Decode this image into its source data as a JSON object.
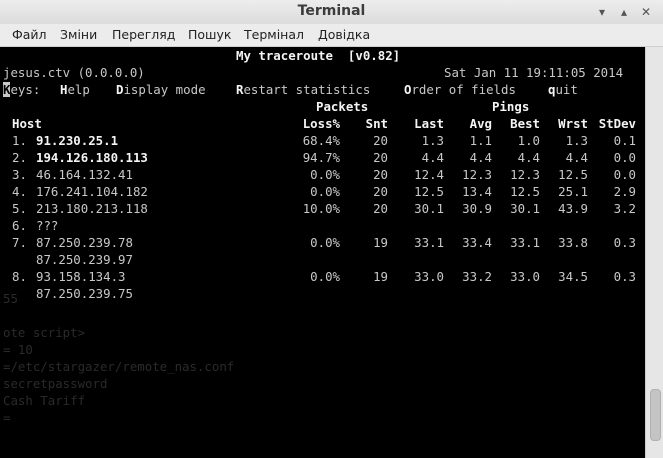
{
  "window": {
    "title": "Terminal"
  },
  "menu": [
    "Файл",
    "Зміни",
    "Перегляд",
    "Пошук",
    "Термінал",
    "Довідка"
  ],
  "mtr": {
    "heading": "My traceroute  [v0.82]",
    "host_info": "jesus.ctv (0.0.0.0)",
    "timestamp": "Sat Jan 11 19:11:05 2014",
    "keys": {
      "label_first": "K",
      "label_rest": "eys:",
      "help_first": "H",
      "help_rest": "elp",
      "display_first": "D",
      "display_rest": "isplay mode",
      "restart_first": "R",
      "restart_rest": "estart statistics",
      "order_first": "O",
      "order_rest": "rder of fields",
      "quit_first": "q",
      "quit_rest": "uit"
    },
    "group_headers": {
      "packets": "Packets",
      "pings": "Pings"
    },
    "columns": {
      "host": "Host",
      "loss": "Loss%",
      "snt": "Snt",
      "last": "Last",
      "avg": "Avg",
      "best": "Best",
      "wrst": "Wrst",
      "stdev": "StDev"
    },
    "hops": [
      {
        "num": "1.",
        "host": "91.230.25.1",
        "loss": "68.4%",
        "snt": "20",
        "last": "1.3",
        "avg": "1.1",
        "best": "1.0",
        "wrst": "1.3",
        "stdev": "0.1"
      },
      {
        "num": "2.",
        "host": "194.126.180.113",
        "loss": "94.7%",
        "snt": "20",
        "last": "4.4",
        "avg": "4.4",
        "best": "4.4",
        "wrst": "4.4",
        "stdev": "0.0"
      },
      {
        "num": "3.",
        "host": "46.164.132.41",
        "loss": "0.0%",
        "snt": "20",
        "last": "12.4",
        "avg": "12.3",
        "best": "12.3",
        "wrst": "12.5",
        "stdev": "0.0"
      },
      {
        "num": "4.",
        "host": "176.241.104.182",
        "loss": "0.0%",
        "snt": "20",
        "last": "12.5",
        "avg": "13.4",
        "best": "12.5",
        "wrst": "25.1",
        "stdev": "2.9"
      },
      {
        "num": "5.",
        "host": "213.180.213.118",
        "loss": "10.0%",
        "snt": "20",
        "last": "30.1",
        "avg": "30.9",
        "best": "30.1",
        "wrst": "43.9",
        "stdev": "3.2"
      },
      {
        "num": "6.",
        "host": "???"
      },
      {
        "num": "7.",
        "host": "87.250.239.78",
        "alt_host": "87.250.239.97",
        "loss": "0.0%",
        "snt": "19",
        "last": "33.1",
        "avg": "33.4",
        "best": "33.1",
        "wrst": "33.8",
        "stdev": "0.3"
      },
      {
        "num": "8.",
        "host": "93.158.134.3",
        "alt_host": "87.250.239.75",
        "loss": "0.0%",
        "snt": "19",
        "last": "33.0",
        "avg": "33.2",
        "best": "33.0",
        "wrst": "34.5",
        "stdev": "0.3"
      }
    ]
  },
  "residual_text": [
    "55",
    "ote script>",
    "= 10",
    "=/etc/stargazer/remote_nas.conf",
    "secretpassword",
    "Cash Tariff",
    "="
  ]
}
